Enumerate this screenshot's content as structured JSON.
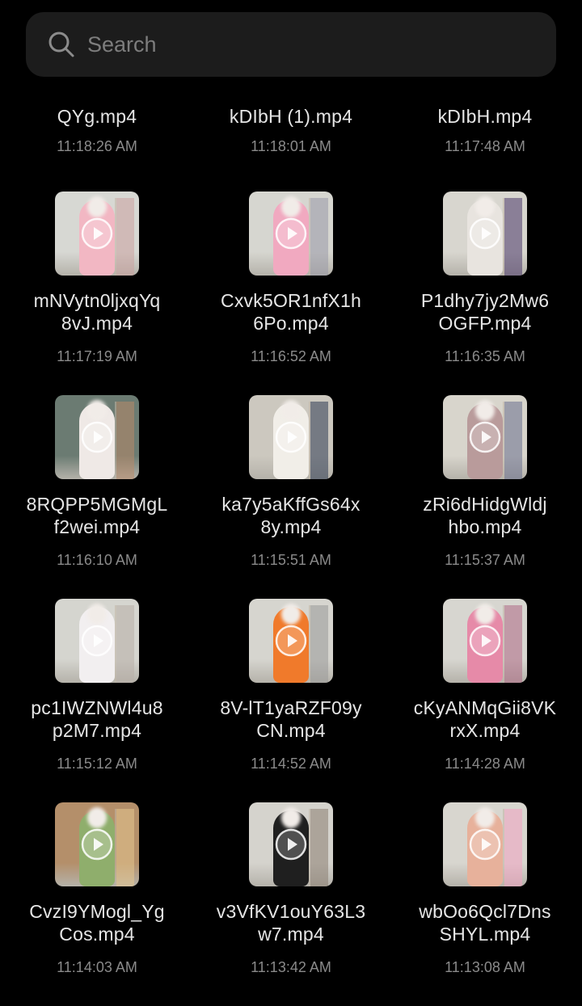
{
  "search": {
    "placeholder": "Search"
  },
  "top_row": [
    {
      "name": "QYg.mp4",
      "time": "11:18:26 AM"
    },
    {
      "name": "kDIbH (1).mp4",
      "time": "11:18:01 AM"
    },
    {
      "name": "kDIbH.mp4",
      "time": "11:17:48 AM"
    }
  ],
  "videos": [
    {
      "name": "mNVytn0ljxqYq\n8vJ.mp4",
      "time": "11:17:19 AM",
      "thumb": "pink-top-arms-up"
    },
    {
      "name": "Cxvk5OR1nfX1h\n6Po.mp4",
      "time": "11:16:52 AM",
      "thumb": "pink-longsleeve"
    },
    {
      "name": "P1dhy7jy2Mw6\nOGFP.mp4",
      "time": "11:16:35 AM",
      "thumb": "purple-jacket-white-top"
    },
    {
      "name": "8RQPP5MGMgL\nf2wei.mp4",
      "time": "11:16:10 AM",
      "thumb": "white-tee-closeup"
    },
    {
      "name": "ka7y5aKffGs64x\n8y.mp4",
      "time": "11:15:51 AM",
      "thumb": "white-tank-grey-hoodie"
    },
    {
      "name": "zRi6dHidgWldj\nhbo.mp4",
      "time": "11:15:37 AM",
      "thumb": "crop-top-arms-up"
    },
    {
      "name": "pc1IWZNWl4u8\np2M7.mp4",
      "time": "11:15:12 AM",
      "thumb": "white-lace-outfit"
    },
    {
      "name": "8V-lT1yaRZF09y\nCN.mp4",
      "time": "11:14:52 AM",
      "thumb": "orange-top-grey-shorts"
    },
    {
      "name": "cKyANMqGii8VK\nrxX.mp4",
      "time": "11:14:28 AM",
      "thumb": "pink-pattern-outfit"
    },
    {
      "name": "CvzI9YMogl_Yg\nCos.mp4",
      "time": "11:14:03 AM",
      "thumb": "floral-top-back"
    },
    {
      "name": "v3VfKV1ouY63L3\nw7.mp4",
      "time": "11:13:42 AM",
      "thumb": "black-outfit"
    },
    {
      "name": "wbOo6Qcl7Dns\nSHYL.mp4",
      "time": "11:13:08 AM",
      "thumb": "pink-bikini"
    }
  ],
  "colors": {
    "background": "#000000",
    "search_bg": "#1c1c1c",
    "filename": "#e6e6e6",
    "timestamp": "#8a8a8a"
  }
}
